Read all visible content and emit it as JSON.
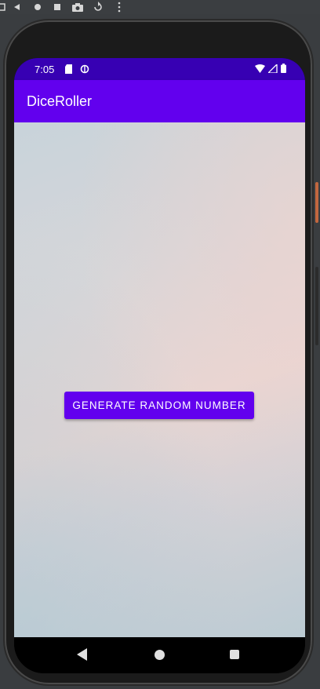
{
  "emulator_toolbar": {
    "icons": [
      "device-frame-icon",
      "back-icon",
      "home-icon",
      "stop-icon",
      "camera-icon",
      "rotate-icon",
      "more-icon"
    ]
  },
  "status_bar": {
    "time": "7:05",
    "notification_icons": [
      "sd-card-icon",
      "data-saver-icon"
    ],
    "system_icons": [
      "wifi-icon",
      "signal-icon",
      "battery-icon"
    ]
  },
  "app_bar": {
    "title": "DiceRoller"
  },
  "main": {
    "button_label": "GENERATE RANDOM NUMBER"
  },
  "nav_bar": {
    "buttons": [
      "back",
      "home",
      "recents"
    ]
  },
  "colors": {
    "status_bar": "#3700b3",
    "app_bar": "#6200ee",
    "button": "#6200ee",
    "text_on_primary": "#ffffff"
  }
}
